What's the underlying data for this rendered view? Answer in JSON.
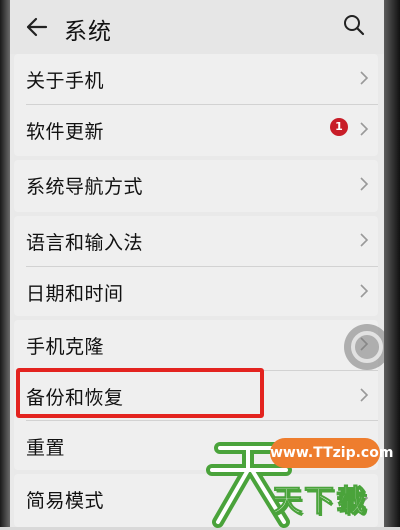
{
  "header": {
    "title": "系统"
  },
  "group1": {
    "about_phone": "关于手机",
    "software_update": "软件更新",
    "update_badge": "1"
  },
  "group2": {
    "system_navigation": "系统导航方式"
  },
  "group3": {
    "language_input": "语言和输入法",
    "date_time": "日期和时间"
  },
  "group4": {
    "phone_clone": "手机克隆",
    "backup_restore": "备份和恢复",
    "reset": "重置"
  },
  "group5": {
    "simple_mode": "简易模式"
  },
  "watermark": {
    "url": "www.TTzip.com",
    "brand": "天下载"
  },
  "colors": {
    "badge": "#c81d28",
    "highlight": "#e3231f",
    "watermark_green": "#4aa33b",
    "watermark_orange": "#ee7d2e"
  }
}
